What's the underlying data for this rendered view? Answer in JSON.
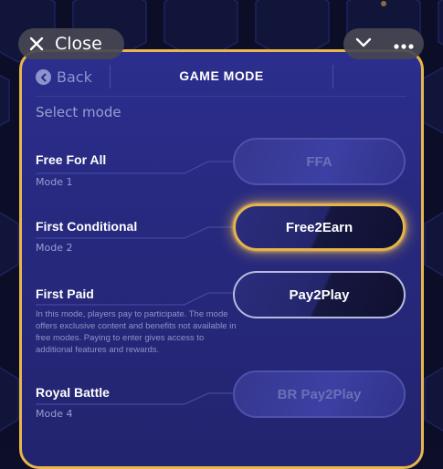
{
  "topbar": {
    "close_label": "Close"
  },
  "header": {
    "back_label": "Back",
    "title": "GAME MODE"
  },
  "select_label": "Select mode",
  "modes": [
    {
      "name": "Free For All",
      "subtitle": "Mode 1",
      "button": "FFA",
      "state": "disabled"
    },
    {
      "name": "First Conditional",
      "subtitle": "Mode 2",
      "button": "Free2Earn",
      "state": "selected"
    },
    {
      "name": "First Paid",
      "description": "In this mode, players pay to participate. The mode offers exclusive content and benefits not available in free modes. Paying to enter gives access to additional features and rewards.",
      "button": "Pay2Play",
      "state": "active"
    },
    {
      "name": "Royal Battle",
      "subtitle": "Mode 4",
      "button": "BR Pay2Play",
      "state": "disabled"
    }
  ],
  "colors": {
    "accent_gold": "#e3b44a",
    "panel": "#2a2c88",
    "muted_text": "#9a9dd0"
  }
}
